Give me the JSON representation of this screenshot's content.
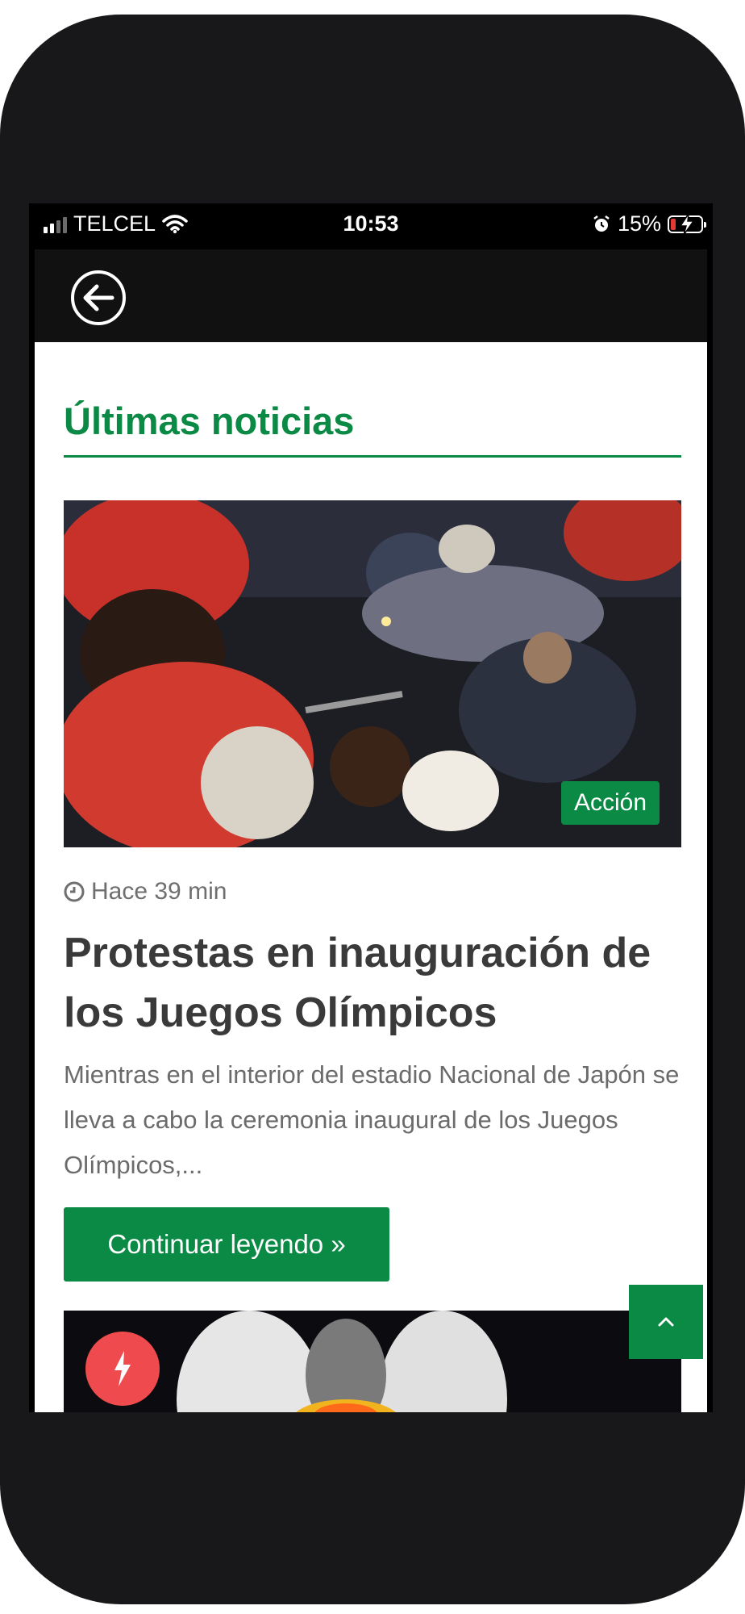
{
  "status_bar": {
    "carrier": "TELCEL",
    "time": "10:53",
    "battery": "15%"
  },
  "section": {
    "title": "Últimas noticias"
  },
  "article": {
    "category": "Acción",
    "time_ago": "Hace 39 min",
    "headline": "Protestas en inauguración de los Juegos Olímpicos",
    "excerpt": "Mientras en el interior del estadio Nacional de Japón se lleva a cabo la ceremonia inaugural de los Juegos Olímpicos,...",
    "cta": "Continuar leyendo »"
  },
  "colors": {
    "accent": "#0b8a45",
    "flash": "#ef4b4f",
    "frame": "#18181a"
  },
  "icons": [
    "signal-icon",
    "wifi-icon",
    "alarm-icon",
    "battery-icon",
    "back-arrow-icon",
    "clock-icon",
    "chevron-up-icon",
    "lightning-icon"
  ]
}
